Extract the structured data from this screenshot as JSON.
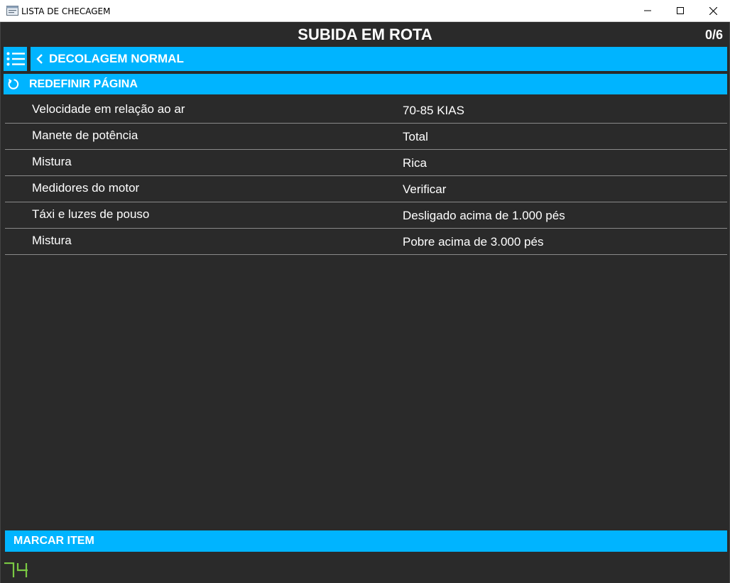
{
  "window": {
    "title": "LISTA DE CHECAGEM"
  },
  "header": {
    "page_title": "SUBIDA EM ROTA",
    "counter": "0/6"
  },
  "nav": {
    "back_label": "DECOLAGEM NORMAL"
  },
  "reset": {
    "label": "REDEFINIR PÁGINA"
  },
  "checklist": [
    {
      "item": "Velocidade em relação ao ar",
      "value": "70-85 KIAS"
    },
    {
      "item": "Manete de potência",
      "value": "Total"
    },
    {
      "item": "Mistura",
      "value": "Rica"
    },
    {
      "item": "Medidores do motor",
      "value": "Verificar"
    },
    {
      "item": "Táxi e luzes de pouso",
      "value": "Desligado acima de 1.000 pés"
    },
    {
      "item": "Mistura",
      "value": "Pobre acima de 3.000 pés"
    }
  ],
  "footer": {
    "mark_label": "MARCAR ITEM",
    "fps_counter": "74"
  },
  "colors": {
    "accent": "#00b4ff",
    "background": "#2a2a2a",
    "divider": "#8a8a8a",
    "fps_green": "#7ac943"
  },
  "icons": {
    "app": "app-window-icon",
    "menu": "list-menu-icon",
    "back": "chevron-left-icon",
    "reset": "refresh-icon"
  }
}
